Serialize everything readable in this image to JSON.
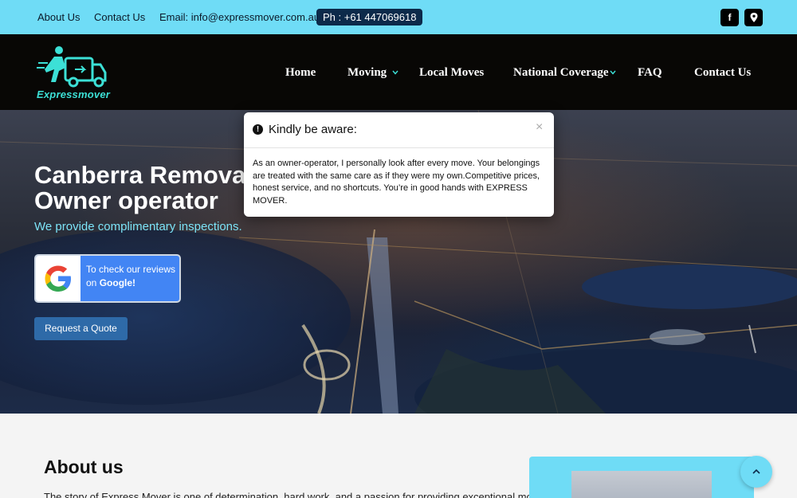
{
  "topbar": {
    "about": "About Us",
    "contact": "Contact Us",
    "email": "Email: info@expressmover.com.au",
    "phone": "Ph : +61 447069618",
    "icons": [
      "facebook-icon",
      "map-pin-icon"
    ]
  },
  "logo": {
    "text": "Expressmover"
  },
  "nav": {
    "items": [
      {
        "label": "Home"
      },
      {
        "label": "Moving"
      },
      {
        "label": "Local Moves"
      },
      {
        "label": "National Coverage"
      },
      {
        "label": "FAQ"
      },
      {
        "label": "Contact Us"
      }
    ]
  },
  "hero": {
    "title_line1": "Canberra Removals",
    "title_line2": "Owner operator",
    "subtitle": "We provide complimentary inspections.",
    "google_text": "To check our reviews on",
    "google_bold": "Google!",
    "quote_button": "Request a Quote"
  },
  "modal": {
    "title": "Kindly be aware:",
    "close": "×",
    "body": "As an owner-operator, I personally look after every move. Your belongings are treated with the same care as if they were my own.Competitive prices, honest service, and no shortcuts. You’re in good hands with EXPRESS MOVER."
  },
  "about": {
    "title": "About us",
    "text": "The story of Express Mover is one of determination, hard work, and a passion for providing exceptional moving"
  },
  "colors": {
    "accent": "#6fdcf6",
    "nav_bg": "#080705",
    "button": "#2e6aa8",
    "google_blue": "#4285f4"
  }
}
